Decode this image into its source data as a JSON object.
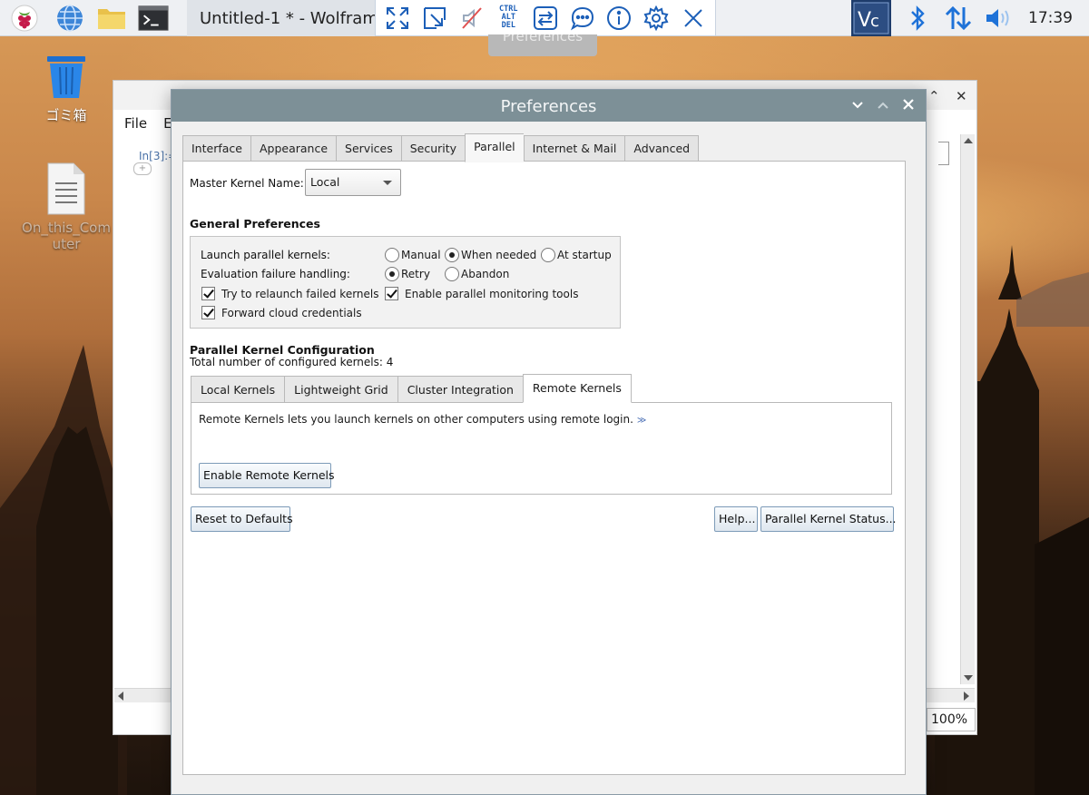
{
  "taskbar": {
    "window_task_title": "Untitled-1 * - Wolfram",
    "clock": "17:39",
    "colors": {
      "accent_blue": "#2a6bd6",
      "panel_bg": "#eef0f3"
    },
    "icons": [
      "raspberry-menu-icon",
      "web-browser-icon",
      "file-manager-icon",
      "terminal-icon",
      "wolfram-icon"
    ],
    "tray_icons": [
      "vnc-icon",
      "bluetooth-icon",
      "network-icon",
      "volume-icon"
    ]
  },
  "vnc_toolbar": {
    "icons": [
      "fullscreen-icon",
      "scale-icon",
      "mute-icon",
      "ctrl-alt-del-icon",
      "transfer-icon",
      "chat-icon",
      "info-icon",
      "settings-icon",
      "close-icon"
    ],
    "ctrl_alt_del_lines": [
      "CTRL",
      "ALT",
      "DEL"
    ],
    "ghost_label": "Preferences"
  },
  "desktop": {
    "icons": [
      {
        "label": "ゴミ箱",
        "icon": "trash-icon"
      },
      {
        "label_line1": "On_this_Com",
        "label_line2": "uter",
        "icon": "document-icon"
      }
    ]
  },
  "background_window": {
    "menu": [
      "File",
      "E"
    ],
    "cell_label": "In[3]:=",
    "zoom": "100%",
    "close_glyph": "✕",
    "maximize_glyph": "⌃"
  },
  "preferences": {
    "title": "Preferences",
    "tabs": [
      "Interface",
      "Appearance",
      "Services",
      "Security",
      "Parallel",
      "Internet & Mail",
      "Advanced"
    ],
    "active_tab": "Parallel",
    "master_kernel_label": "Master Kernel Name:",
    "master_kernel_value": "Local",
    "general": {
      "heading": "General Preferences",
      "launch_label": "Launch parallel kernels:",
      "launch_options": [
        "Manual",
        "When needed",
        "At startup"
      ],
      "launch_selected": "When needed",
      "failure_label": "Evaluation failure handling:",
      "failure_options": [
        "Retry",
        "Abandon"
      ],
      "failure_selected": "Retry",
      "relaunch_label": "Try to relaunch failed kernels",
      "relaunch_checked": true,
      "monitoring_label": "Enable parallel monitoring tools",
      "monitoring_checked": true,
      "cloud_label": "Forward cloud credentials",
      "cloud_checked": true
    },
    "config": {
      "heading": "Parallel Kernel Configuration",
      "total_label": "Total number of configured kernels: 4",
      "subtabs": [
        "Local Kernels",
        "Lightweight Grid",
        "Cluster Integration",
        "Remote Kernels"
      ],
      "active_subtab": "Remote Kernels",
      "description": "Remote Kernels lets you launch kernels on other computers using remote login.",
      "more_link": "≫",
      "enable_button": "Enable Remote Kernels"
    },
    "buttons": {
      "reset": "Reset to Defaults",
      "help": "Help...",
      "status": "Parallel Kernel Status..."
    }
  }
}
